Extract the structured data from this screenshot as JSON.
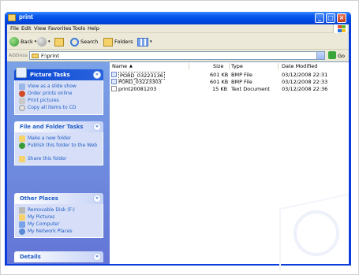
{
  "window": {
    "title": "print"
  },
  "menu": [
    "File",
    "Edit",
    "View",
    "Favorites",
    "Tools",
    "Help"
  ],
  "toolbar": {
    "back": "Back",
    "search": "Search",
    "folders": "Folders"
  },
  "address": {
    "label": "Address",
    "value": "F:\\print",
    "go": "Go"
  },
  "taskpane": {
    "picture_tasks": {
      "title": "Picture Tasks",
      "items": [
        "View as a slide show",
        "Order prints online",
        "Print pictures",
        "Copy all items to CD"
      ]
    },
    "file_folder_tasks": {
      "title": "File and Folder Tasks",
      "items": [
        "Make a new folder",
        "Publish this folder to the Web",
        "Share this folder"
      ]
    },
    "other_places": {
      "title": "Other Places",
      "items": [
        "Removable Disk (F:)",
        "My Pictures",
        "My Computer",
        "My Network Places"
      ]
    },
    "details": {
      "title": "Details"
    }
  },
  "columns": {
    "name": "Name",
    "size": "Size",
    "type": "Type",
    "date": "Date Modified"
  },
  "files": [
    {
      "name": "PORD_03223136",
      "size": "601 KB",
      "type": "BMP File",
      "date": "03/12/2008 22:31"
    },
    {
      "name": "PORD_03223303",
      "size": "601 KB",
      "type": "BMP File",
      "date": "03/12/2008 22:33"
    },
    {
      "name": "print20081203",
      "size": "15 KB",
      "type": "Text Document",
      "date": "03/12/2008 22:36"
    }
  ]
}
